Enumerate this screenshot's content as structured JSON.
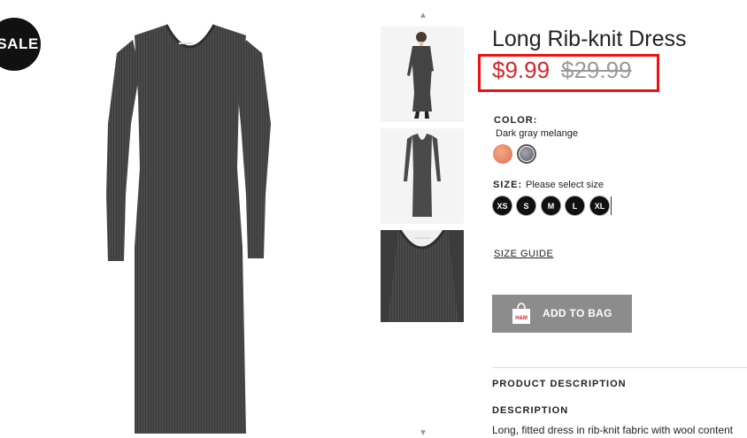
{
  "badge": {
    "label": "SALE"
  },
  "product": {
    "title": "Long Rib-knit Dress",
    "price_sale": "$9.99",
    "price_original": "$29.99"
  },
  "color": {
    "label": "COLOR:",
    "selected": "Dark gray melange",
    "swatches": [
      {
        "name": "coral",
        "hex": "#e98866"
      },
      {
        "name": "dark-gray-melange",
        "hex": "#7a7a82"
      }
    ]
  },
  "size": {
    "label": "SIZE:",
    "hint": "Please select size",
    "options": [
      "XS",
      "S",
      "M",
      "L",
      "XL"
    ]
  },
  "links": {
    "size_guide": "SIZE GUIDE"
  },
  "cart": {
    "add_label": "ADD TO BAG",
    "icon_text": "H&M"
  },
  "description": {
    "section_title": "PRODUCT DESCRIPTION",
    "heading": "DESCRIPTION",
    "text": "Long, fitted dress in rib-knit fabric with wool content"
  },
  "icons": {
    "thumb_up": "chevron-up-icon",
    "thumb_down": "chevron-down-icon",
    "bag": "shopping-bag-icon"
  },
  "colors": {
    "sale_red": "#d6262b",
    "highlight_box": "#ee1111",
    "button_gray": "#8c8c8c"
  }
}
